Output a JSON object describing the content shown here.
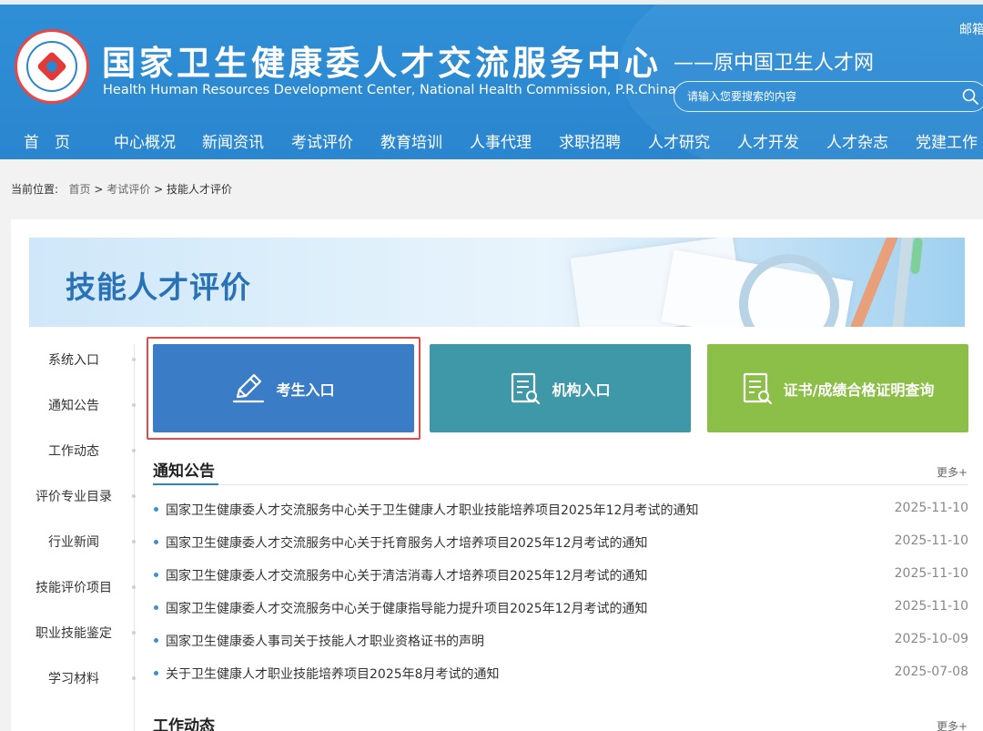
{
  "header": {
    "site_title": "国家卫生健康委人才交流服务中心",
    "site_subtitle": "Health Human Resources Development Center, National Health Commission, P.R.China",
    "site_original": "——原中国卫生人才网",
    "top_mail": "邮箱",
    "search_placeholder": "请输入您要搜索的内容",
    "colors": {
      "header_bg": "#2a86cf",
      "accent": "#2a86cf"
    }
  },
  "nav": [
    "首　页",
    "中心概况",
    "新闻资讯",
    "考试评价",
    "教育培训",
    "人事代理",
    "求职招聘",
    "人才研究",
    "人才开发",
    "人才杂志",
    "党建工作"
  ],
  "breadcrumb": {
    "label": "当前位置:",
    "home": "首页",
    "sep1": ">",
    "level1": "考试评价",
    "sep2": ">",
    "current": "技能人才评价"
  },
  "banner": {
    "title": "技能人才评价"
  },
  "sidebar": [
    "系统入口",
    "通知公告",
    "工作动态",
    "评价专业目录",
    "行业新闻",
    "技能评价项目",
    "职业技能鉴定",
    "学习材料"
  ],
  "entries": [
    {
      "label": "考生入口",
      "icon": "pen-edit-icon",
      "color": "#3a7cc6"
    },
    {
      "label": "机构入口",
      "icon": "document-search-icon",
      "color": "#3f98a8"
    },
    {
      "label": "证书/成绩合格证明查询",
      "icon": "document-search-icon",
      "color": "#8cbf47"
    }
  ],
  "notices": {
    "title": "通知公告",
    "more": "更多+",
    "items": [
      {
        "title": "国家卫生健康委人才交流服务中心关于卫生健康人才职业技能培养项目2025年12月考试的通知",
        "date": "2025-11-10"
      },
      {
        "title": "国家卫生健康委人才交流服务中心关于托育服务人才培养项目2025年12月考试的通知",
        "date": "2025-11-10"
      },
      {
        "title": "国家卫生健康委人才交流服务中心关于清洁消毒人才培养项目2025年12月考试的通知",
        "date": "2025-11-10"
      },
      {
        "title": "国家卫生健康委人才交流服务中心关于健康指导能力提升项目2025年12月考试的通知",
        "date": "2025-11-10"
      },
      {
        "title": "国家卫生健康委人事司关于技能人才职业资格证书的声明",
        "date": "2025-10-09"
      },
      {
        "title": "关于卫生健康人才职业技能培养项目2025年8月考试的通知",
        "date": "2025-07-08"
      }
    ]
  },
  "work": {
    "title": "工作动态",
    "more": "更多+"
  }
}
